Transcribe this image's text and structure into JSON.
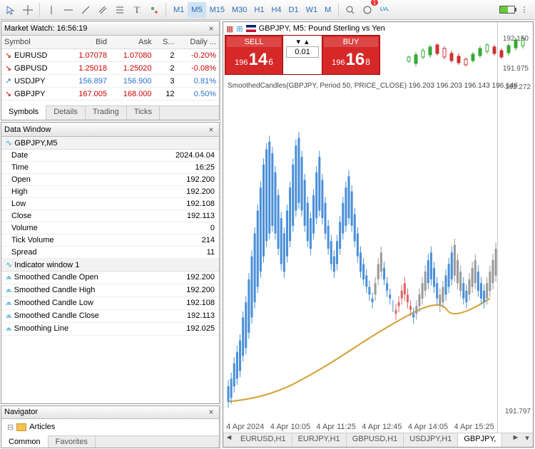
{
  "toolbar": {
    "timeframes": [
      "M1",
      "M5",
      "M15",
      "M30",
      "H1",
      "H4",
      "D1",
      "W1",
      "M"
    ],
    "active_tf": "M5",
    "badge_count": "1",
    "lvl_label": "LVL"
  },
  "market_watch": {
    "title": "Market Watch: 16:56:19",
    "cols": [
      "Symbol",
      "Bid",
      "Ask",
      "S...",
      "Daily ..."
    ],
    "rows": [
      {
        "dir": "down",
        "color": "#c00",
        "sym": "EURUSD",
        "bid": "1.07078",
        "ask": "1.07080",
        "sp": "2",
        "daily": "-0.20%",
        "dcolor": "#c00"
      },
      {
        "dir": "down",
        "color": "#c00",
        "sym": "GBPUSD",
        "bid": "1.25018",
        "ask": "1.25020",
        "sp": "2",
        "daily": "-0.08%",
        "dcolor": "#c00"
      },
      {
        "dir": "up",
        "color": "#2a72d4",
        "sym": "USDJPY",
        "bid": "156.897",
        "ask": "156.900",
        "sp": "3",
        "daily": "0.81%",
        "dcolor": "#2a72d4"
      },
      {
        "dir": "down",
        "color": "#c00",
        "sym": "GBPJPY",
        "bid": "167.005",
        "ask": "168.000",
        "sp": "12",
        "daily": "0.50%",
        "dcolor": "#2a72d4"
      }
    ],
    "tabs": [
      "Symbols",
      "Details",
      "Trading",
      "Ticks"
    ],
    "active_tab": "Symbols"
  },
  "data_window": {
    "title": "Data Window",
    "symbol_header": "GBPJPY,M5",
    "rows": [
      {
        "l": "Date",
        "v": "2024.04.04"
      },
      {
        "l": "Time",
        "v": "16:25"
      },
      {
        "l": "Open",
        "v": "192.200"
      },
      {
        "l": "High",
        "v": "192.200"
      },
      {
        "l": "Low",
        "v": "192.108"
      },
      {
        "l": "Close",
        "v": "192.113"
      },
      {
        "l": "Volume",
        "v": "0"
      },
      {
        "l": "Tick Volume",
        "v": "214"
      },
      {
        "l": "Spread",
        "v": "11"
      }
    ],
    "indicator_header": "Indicator window 1",
    "indicator_rows": [
      {
        "l": "Smoothed Candle Open",
        "v": "192.200"
      },
      {
        "l": "Smoothed Candle High",
        "v": "192.200"
      },
      {
        "l": "Smoothed Candle Low",
        "v": "192.108"
      },
      {
        "l": "Smoothed Candle Close",
        "v": "192.113"
      },
      {
        "l": "Smoothing Line",
        "v": "192.025"
      }
    ]
  },
  "navigator": {
    "title": "Navigator",
    "item": "Articles",
    "tabs": [
      "Common",
      "Favorites"
    ],
    "active_tab": "Common"
  },
  "chart": {
    "title": "GBPJPY, M5: Pound Sterling vs Yen",
    "indicator_text": "SmoothedCandles(GBPJPY, Period 50, PRICE_CLOSE) 196.203 196.203 196.143 196.146",
    "sell_label": "SELL",
    "buy_label": "BUY",
    "lot_value": "0.01",
    "sell_prefix": "196",
    "sell_big": "14",
    "sell_sup": "6",
    "buy_prefix": "196",
    "buy_big": "16",
    "buy_sup": "8",
    "mini_prices": [
      "192.150",
      "191.975"
    ],
    "main_prices": [
      "192.272",
      "191.797"
    ],
    "time_labels": [
      "4 Apr 2024",
      "4 Apr 10:05",
      "4 Apr 11:25",
      "4 Apr 12:45",
      "4 Apr 14:05",
      "4 Apr 15:25"
    ],
    "tabs": [
      "EURUSD,H1",
      "EURJPY,H1",
      "GBPUSD,H1",
      "USDJPY,H1",
      "GBPJPY,"
    ],
    "active_tab": "GBPJPY,"
  }
}
